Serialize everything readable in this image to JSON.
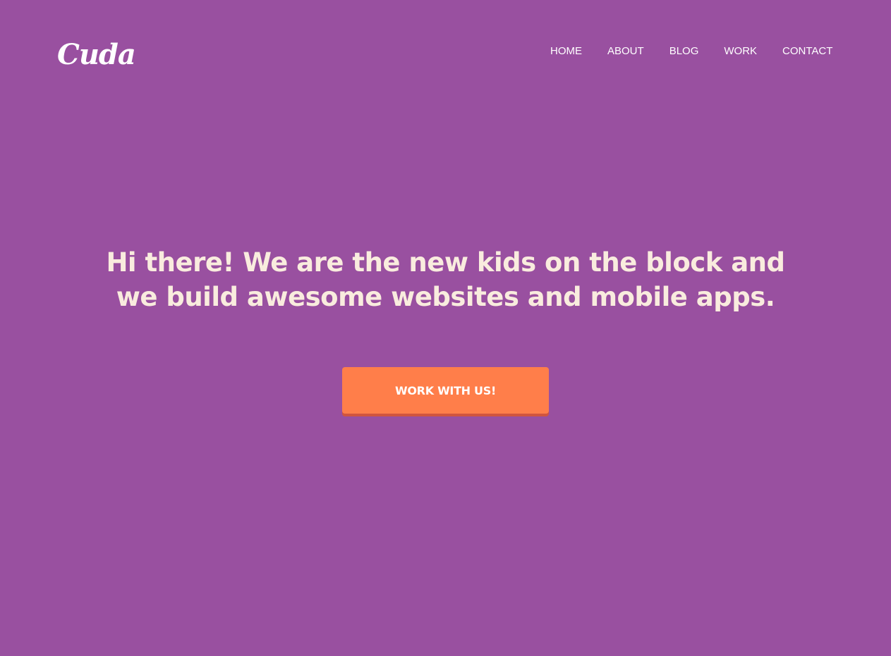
{
  "header": {
    "logo_text": "Cuda",
    "nav": {
      "items": [
        {
          "label": "HOME"
        },
        {
          "label": "ABOUT"
        },
        {
          "label": "BLOG"
        },
        {
          "label": "WORK"
        },
        {
          "label": "CONTACT"
        }
      ]
    }
  },
  "hero": {
    "heading": "Hi there! We are the new kids on the block and we build awesome websites and mobile apps.",
    "cta_label": "WORK WITH US!"
  },
  "colors": {
    "background": "#9950a0",
    "heading_text": "#f9ecde",
    "cta_background": "#ff7e4a",
    "cta_shadow": "#d0553f",
    "nav_text": "#ffffff"
  }
}
